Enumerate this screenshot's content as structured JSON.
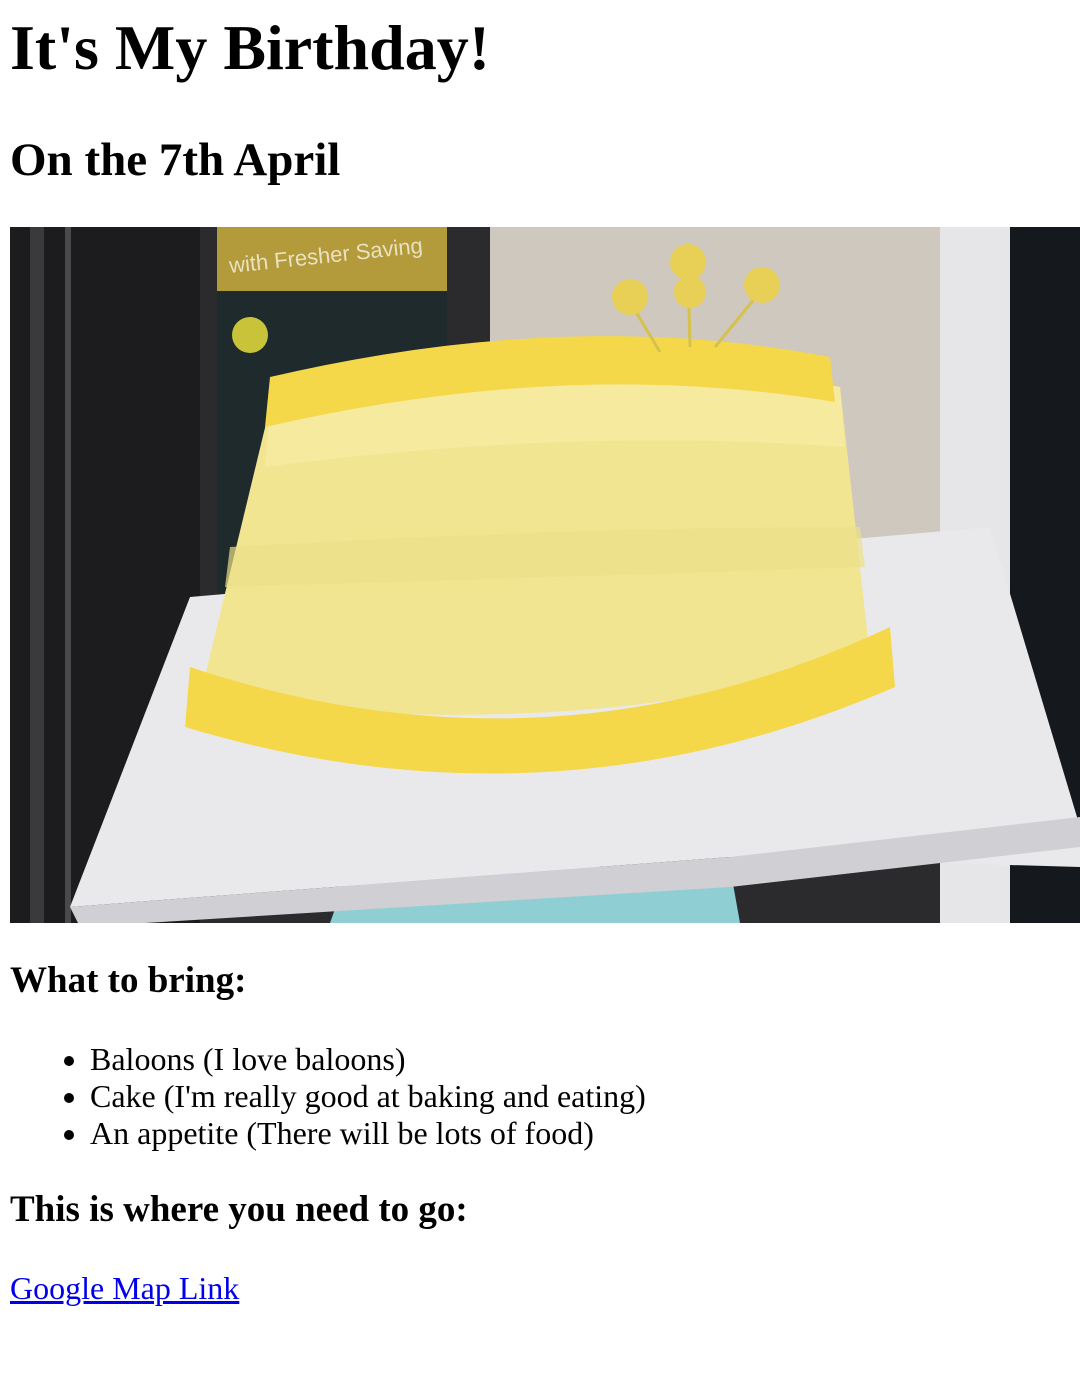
{
  "page": {
    "title": "It's My Birthday!",
    "date_heading": "On the 7th April"
  },
  "photo": {
    "alt": "Yellow frosted birthday cake on a white plate",
    "colors": {
      "frosting": "#f3e48e",
      "piping": "#f5d84a",
      "plate": "#e9e9ec",
      "stand": "#8fcfd3",
      "background": "#2a2a2a"
    },
    "background_sign_text": "with Fresher Saving"
  },
  "bring": {
    "heading": "What to bring:",
    "items": [
      "Baloons (I love baloons)",
      "Cake (I'm really good at baking and eating)",
      "An appetite (There will be lots of food)"
    ]
  },
  "directions": {
    "heading": "This is where you need to go:",
    "link_label": "Google Map Link",
    "link_color": "#0000ee"
  }
}
